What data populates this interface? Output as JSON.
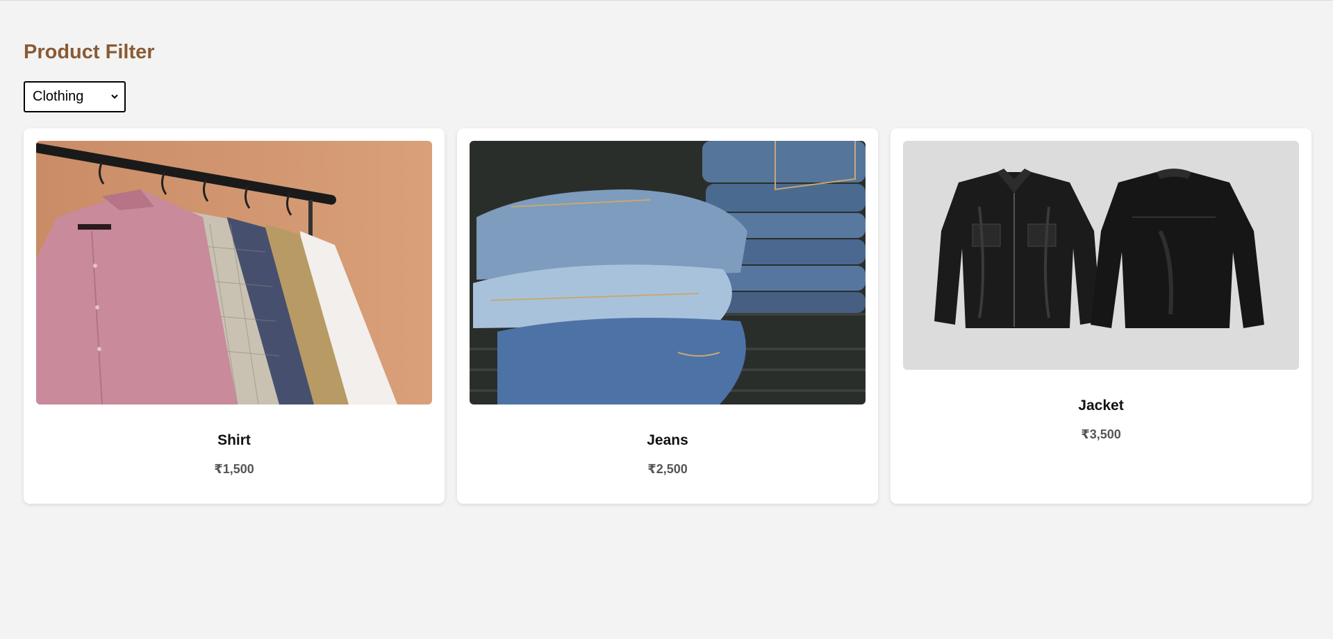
{
  "page": {
    "title": "Product Filter"
  },
  "filter": {
    "selected": "Clothing",
    "icon": "chevron-down-icon"
  },
  "products": [
    {
      "name": "Shirt",
      "price": "₹1,500",
      "image": "shirts-on-rack-image"
    },
    {
      "name": "Jeans",
      "price": "₹2,500",
      "image": "folded-jeans-image"
    },
    {
      "name": "Jacket",
      "price": "₹3,500",
      "image": "leather-jacket-image"
    }
  ],
  "colors": {
    "title": "#8b5a33",
    "background": "#f3f3f3",
    "card": "#ffffff",
    "price": "#555555"
  }
}
